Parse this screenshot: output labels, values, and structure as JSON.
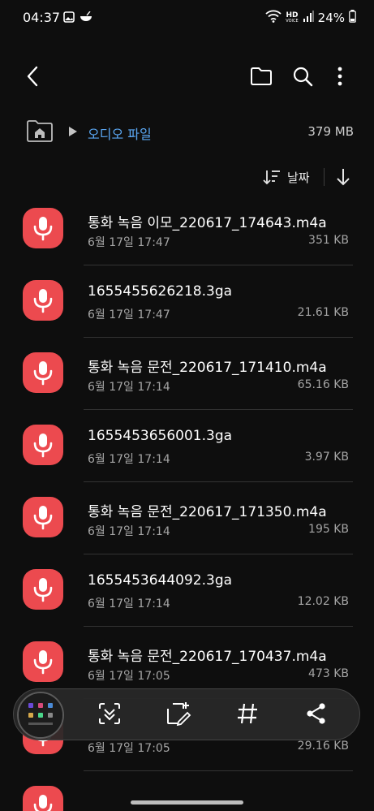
{
  "status_bar": {
    "time": "04:37",
    "battery": "24%",
    "hd_label": "HD",
    "voice_label": "VOICE"
  },
  "app_bar": {
    "back_icon": "back-arrow-icon",
    "folder_icon": "folder-icon",
    "search_icon": "search-icon",
    "more_icon": "more-vert-icon"
  },
  "breadcrumb": {
    "current_folder": "오디오 파일",
    "storage_size": "379 MB"
  },
  "sort": {
    "label": "날짜"
  },
  "files": [
    {
      "name": "통화 녹음 이모_220617_174643.m4a",
      "date": "6월 17일 17:47",
      "size": "351 KB"
    },
    {
      "name": "1655455626218.3ga",
      "date": "6월 17일 17:47",
      "size": "21.61 KB"
    },
    {
      "name": "통화 녹음 문전_220617_171410.m4a",
      "date": "6월 17일 17:14",
      "size": "65.16 KB"
    },
    {
      "name": "1655453656001.3ga",
      "date": "6월 17일 17:14",
      "size": "3.97 KB"
    },
    {
      "name": "통화 녹음 문전_220617_171350.m4a",
      "date": "6월 17일 17:14",
      "size": "195 KB"
    },
    {
      "name": "1655453644092.3ga",
      "date": "6월 17일 17:14",
      "size": "12.02 KB"
    },
    {
      "name": "통화 녹음 문전_220617_170437.m4a",
      "date": "6월 17일 17:05",
      "size": "473 KB"
    },
    {
      "name": "",
      "date": "6월 17일 17:05",
      "size": "29.16 KB"
    },
    {
      "name": "",
      "date": "",
      "size": ""
    }
  ],
  "colors": {
    "background": "#0e0e0e",
    "accent": "#5aa6f2",
    "file_icon": "#ec4a4f"
  },
  "toolbar": {
    "icons": [
      "scan-text-icon",
      "crop-edit-icon",
      "hashtag-icon",
      "share-icon"
    ]
  }
}
